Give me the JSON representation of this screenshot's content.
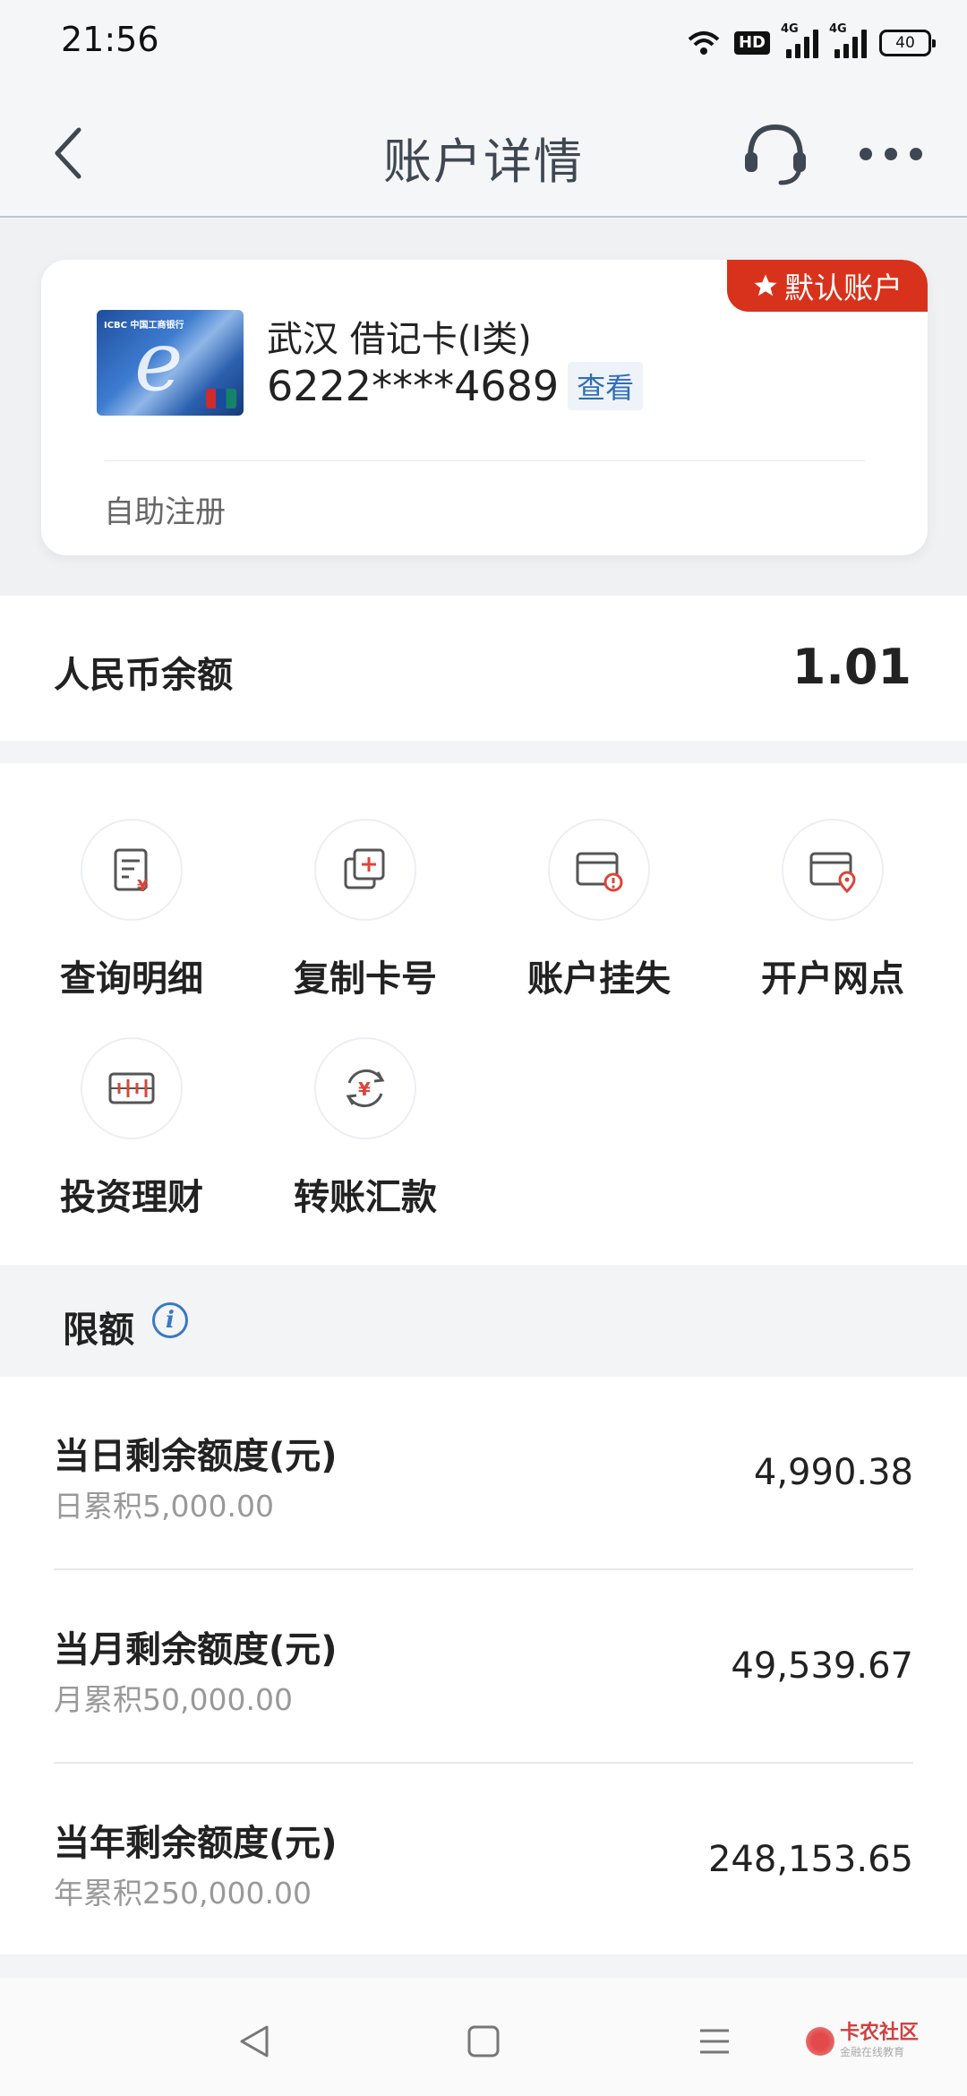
{
  "status_bar": {
    "time": "21:56",
    "hd_label": "HD",
    "net_label_1": "4G",
    "net_label_2": "4G",
    "battery": "40"
  },
  "header": {
    "title": "账户详情",
    "back_icon": "chevron-left-icon",
    "service_icon": "headset-icon",
    "more_icon": "more-dots-icon"
  },
  "card": {
    "default_tag": "默认账户",
    "name": "武汉 借记卡(I类)",
    "number": "6222****4689",
    "view_label": "查看",
    "footer": "自助注册",
    "image_logo": "ICBC 中国工商银行"
  },
  "balance": {
    "label": "人民币余额",
    "value": "1.01"
  },
  "actions": [
    {
      "label": "查询明细",
      "icon": "statement-icon"
    },
    {
      "label": "复制卡号",
      "icon": "copy-card-icon"
    },
    {
      "label": "账户挂失",
      "icon": "report-loss-icon"
    },
    {
      "label": "开户网点",
      "icon": "branch-location-icon"
    },
    {
      "label": "投资理财",
      "icon": "investment-icon"
    },
    {
      "label": "转账汇款",
      "icon": "transfer-icon"
    }
  ],
  "limits": {
    "title": "限额",
    "info_icon": "info-icon",
    "rows": [
      {
        "title": "当日剩余额度(元)",
        "sub": "日累积5,000.00",
        "value": "4,990.38"
      },
      {
        "title": "当月剩余额度(元)",
        "sub": "月累积50,000.00",
        "value": "49,539.67"
      },
      {
        "title": "当年剩余额度(元)",
        "sub": "年累积250,000.00",
        "value": "248,153.65"
      }
    ]
  },
  "watermark": {
    "text": "卡农社区",
    "sub": "金融在线教育"
  },
  "colors": {
    "accent_red": "#d8321c",
    "link_blue": "#2f6fb4",
    "icon_red": "#d8463a"
  }
}
